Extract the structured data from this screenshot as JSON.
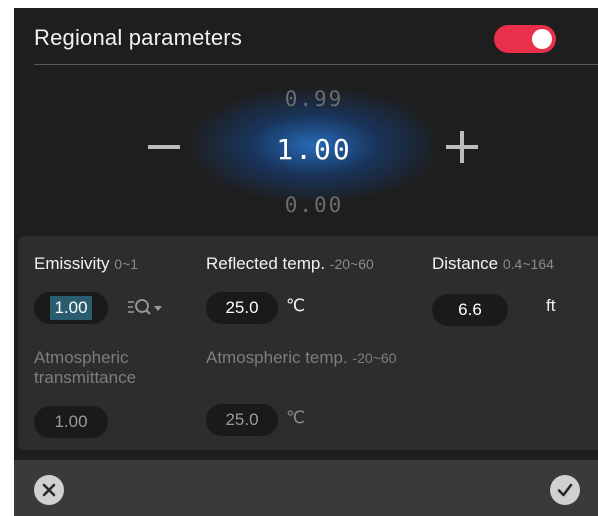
{
  "header": {
    "title": "Regional parameters",
    "toggle_on": true,
    "toggle_color": "#e8304a"
  },
  "picker": {
    "prev_value": "0.99",
    "current_value": "1.00",
    "next_value": "0.00",
    "minus_icon": "minus-icon",
    "plus_icon": "plus-icon",
    "glow_color": "#2878d2"
  },
  "params": {
    "emissivity": {
      "label": "Emissivity",
      "range": "0~1",
      "value": "1.00",
      "icon": "magnify-dropdown-icon"
    },
    "reflected_temp": {
      "label": "Reflected temp.",
      "range": "-20~60",
      "value": "25.0",
      "unit": "℃"
    },
    "distance": {
      "label": "Distance",
      "range": "0.4~164",
      "value": "6.6",
      "unit": "ft"
    },
    "atm_transmittance": {
      "label": "Atmospheric transmittance",
      "value": "1.00"
    },
    "atm_temp": {
      "label": "Atmospheric temp.",
      "range": "-20~60",
      "value": "25.0",
      "unit": "℃"
    }
  },
  "footer": {
    "cancel_icon": "close-icon",
    "confirm_icon": "check-icon"
  }
}
